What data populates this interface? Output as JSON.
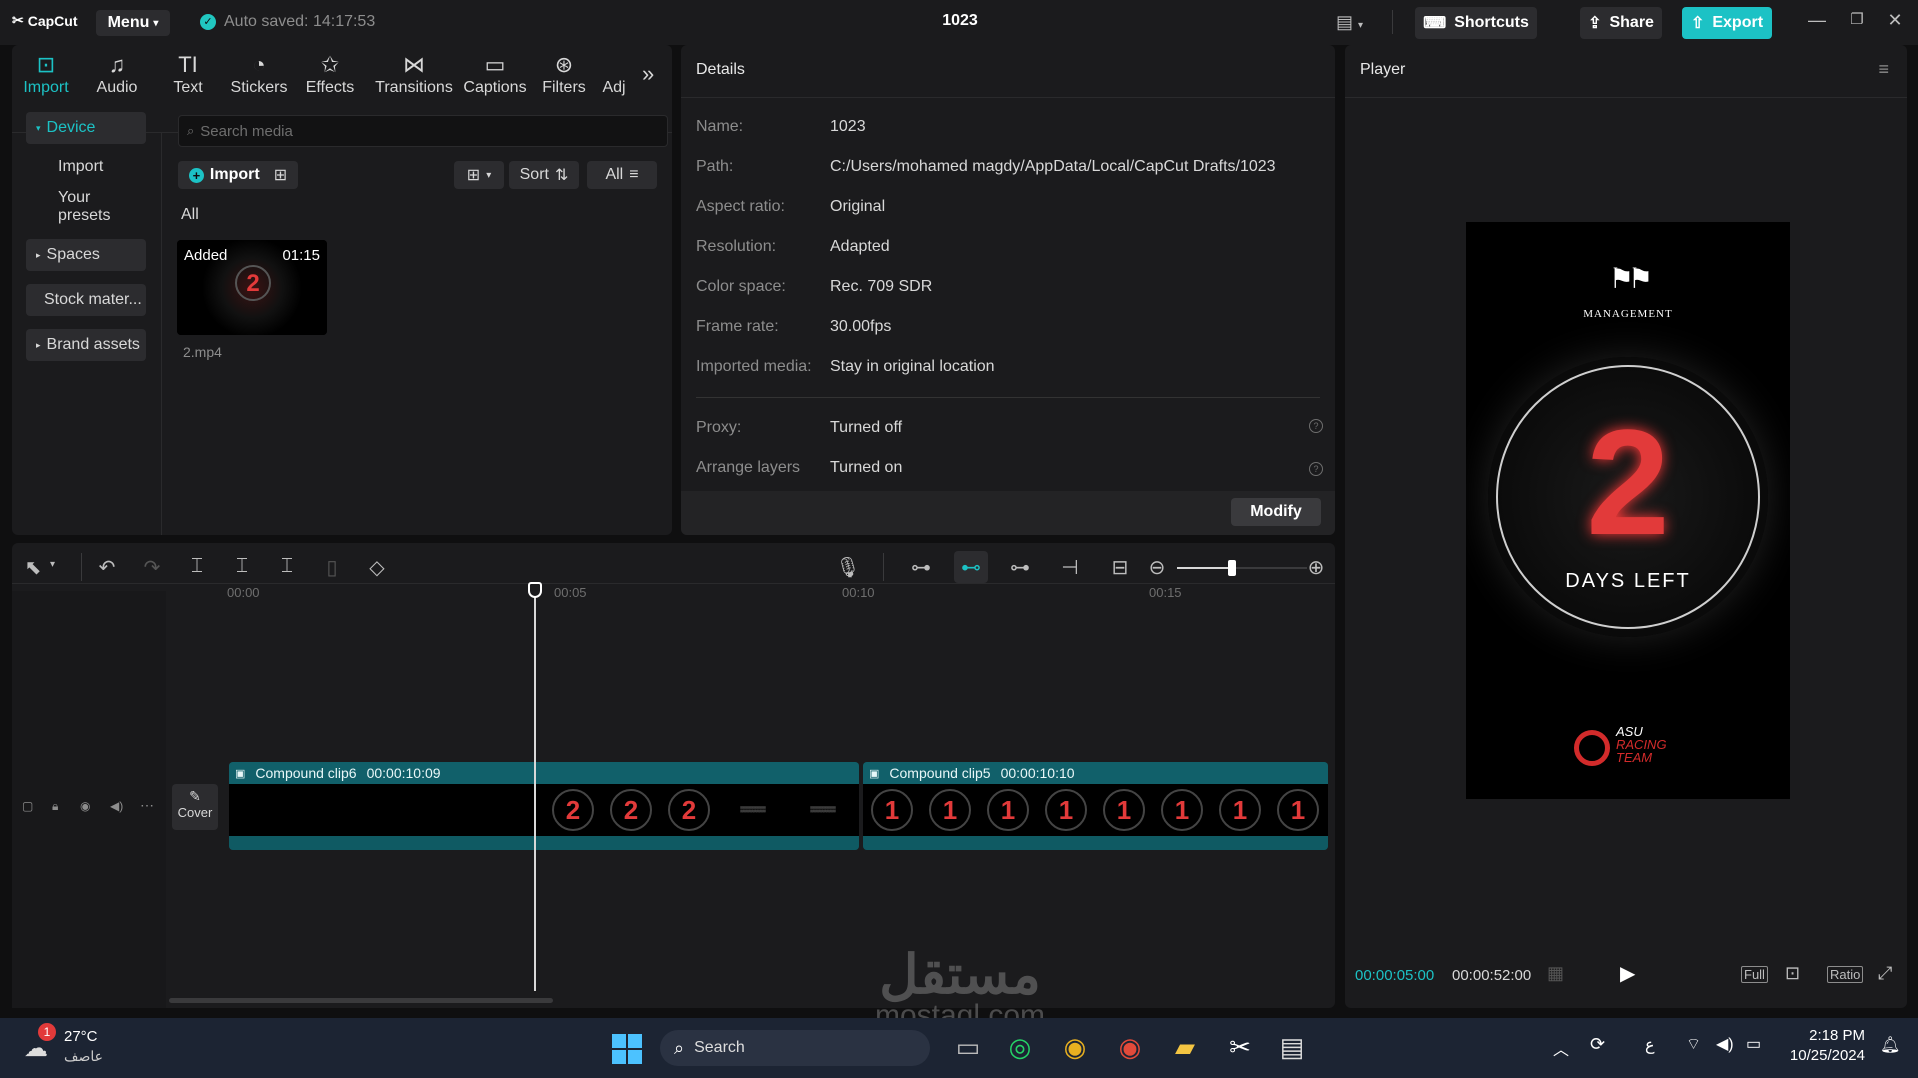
{
  "titlebar": {
    "app_name": "CapCut",
    "menu_label": "Menu",
    "autosave": "Auto saved: 14:17:53",
    "project_title": "1023",
    "shortcuts_label": "Shortcuts",
    "share_label": "Share",
    "export_label": "Export"
  },
  "toolbar": {
    "tabs": [
      {
        "label": "Import",
        "icon": "import-icon"
      },
      {
        "label": "Audio",
        "icon": "audio-icon"
      },
      {
        "label": "Text",
        "icon": "text-icon"
      },
      {
        "label": "Stickers",
        "icon": "stickers-icon"
      },
      {
        "label": "Effects",
        "icon": "effects-icon"
      },
      {
        "label": "Transitions",
        "icon": "transitions-icon"
      },
      {
        "label": "Captions",
        "icon": "captions-icon"
      },
      {
        "label": "Filters",
        "icon": "filters-icon"
      },
      {
        "label": "Adj",
        "icon": "adjust-icon"
      }
    ],
    "active_tab": "Import"
  },
  "sidebar": {
    "items": [
      {
        "label": "Device"
      },
      {
        "label": "Import"
      },
      {
        "label": "Your presets"
      },
      {
        "label": "Spaces"
      },
      {
        "label": "Stock mater..."
      },
      {
        "label": "Brand assets"
      }
    ]
  },
  "media": {
    "search_placeholder": "Search media",
    "import_label": "Import",
    "sort_label": "Sort",
    "filter_label": "All",
    "section_label": "All",
    "items": [
      {
        "badge": "Added",
        "duration": "01:15",
        "filename": "2.mp4",
        "thumb_text": "2"
      }
    ]
  },
  "details": {
    "title": "Details",
    "rows": [
      {
        "label": "Name:",
        "value": "1023"
      },
      {
        "label": "Path:",
        "value": "C:/Users/mohamed magdy/AppData/Local/CapCut Drafts/1023"
      },
      {
        "label": "Aspect ratio:",
        "value": "Original"
      },
      {
        "label": "Resolution:",
        "value": "Adapted"
      },
      {
        "label": "Color space:",
        "value": "Rec. 709 SDR"
      },
      {
        "label": "Frame rate:",
        "value": "30.00fps"
      },
      {
        "label": "Imported media:",
        "value": "Stay in original location"
      }
    ],
    "rows2": [
      {
        "label": "Proxy:",
        "value": "Turned off"
      },
      {
        "label": "Arrange layers",
        "value": "Turned on"
      }
    ],
    "modify_label": "Modify"
  },
  "player": {
    "title": "Player",
    "current_time": "00:00:05:00",
    "total_time": "00:00:52:00",
    "full_label": "Full",
    "ratio_label": "Ratio",
    "preview": {
      "brand": "MANAGEMENT",
      "big_number": "2",
      "caption": "DAYS LEFT",
      "team_line1": "ASU",
      "team_line2": "RACING",
      "team_line3": "TEAM"
    }
  },
  "timeline": {
    "ruler": [
      "00:00",
      "00:05",
      "00:10",
      "00:15"
    ],
    "cover_label": "Cover",
    "clips": [
      {
        "name": "Compound clip6",
        "duration": "00:00:10:09",
        "frames": [
          "2",
          "2",
          "2"
        ]
      },
      {
        "name": "Compound clip5",
        "duration": "00:00:10:10",
        "frames": [
          "1",
          "1",
          "1",
          "1",
          "1",
          "1",
          "1",
          "1"
        ]
      }
    ],
    "zoom_level": 0.42
  },
  "taskbar": {
    "weather_temp": "27°C",
    "weather_desc": "عاصف",
    "weather_badge": "1",
    "search_label": "Search",
    "time": "2:18 PM",
    "date": "10/25/2024",
    "lang": "ع"
  },
  "watermark": {
    "line1": "مستقل",
    "line2": "mostaql.com"
  },
  "colors": {
    "accent": "#1cc2c5",
    "clip": "#11606a",
    "panel": "#1b1b1d",
    "red": "#e23a3a"
  }
}
